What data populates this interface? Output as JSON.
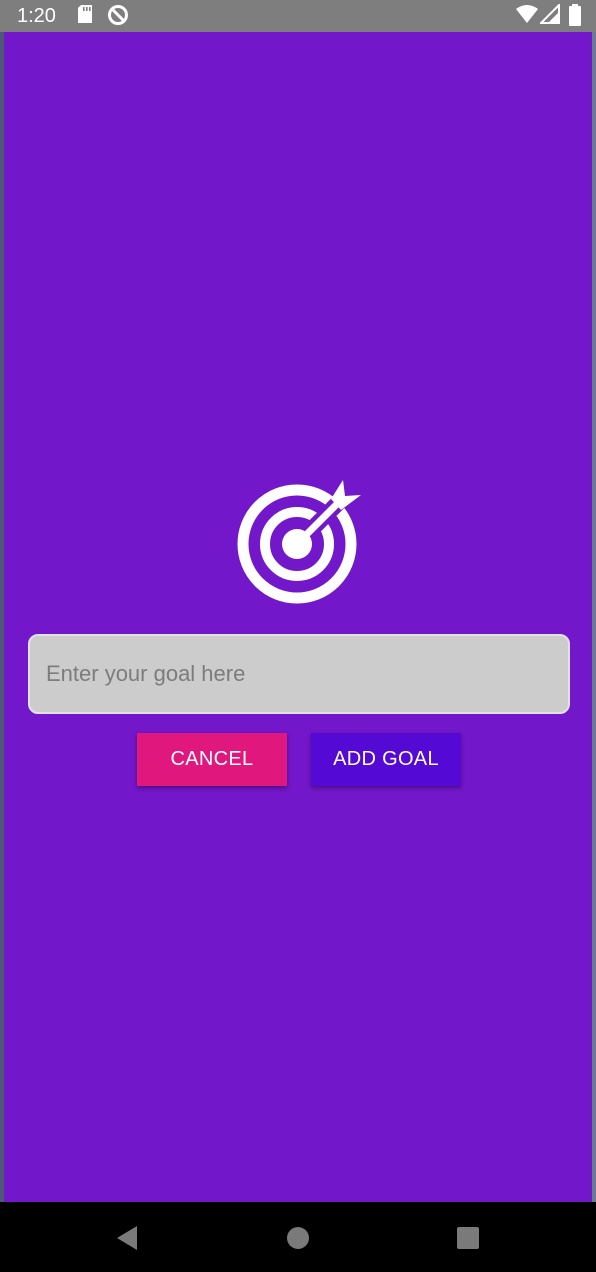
{
  "status_bar": {
    "time": "1:20",
    "icons": [
      "sd-card-icon",
      "do-not-disturb-icon",
      "wifi-icon",
      "signal-icon",
      "battery-icon"
    ]
  },
  "app": {
    "background_color": "#7217c9",
    "icon": "target-arrow-icon",
    "goal_input": {
      "value": "",
      "placeholder": "Enter your goal here"
    },
    "cancel_button": {
      "label": "CANCEL",
      "color": "#e0187d"
    },
    "add_goal_button": {
      "label": "ADD GOAL",
      "color": "#5409d4"
    }
  },
  "navigation_bar": {
    "buttons": [
      "back-icon",
      "home-icon",
      "recents-icon"
    ]
  }
}
